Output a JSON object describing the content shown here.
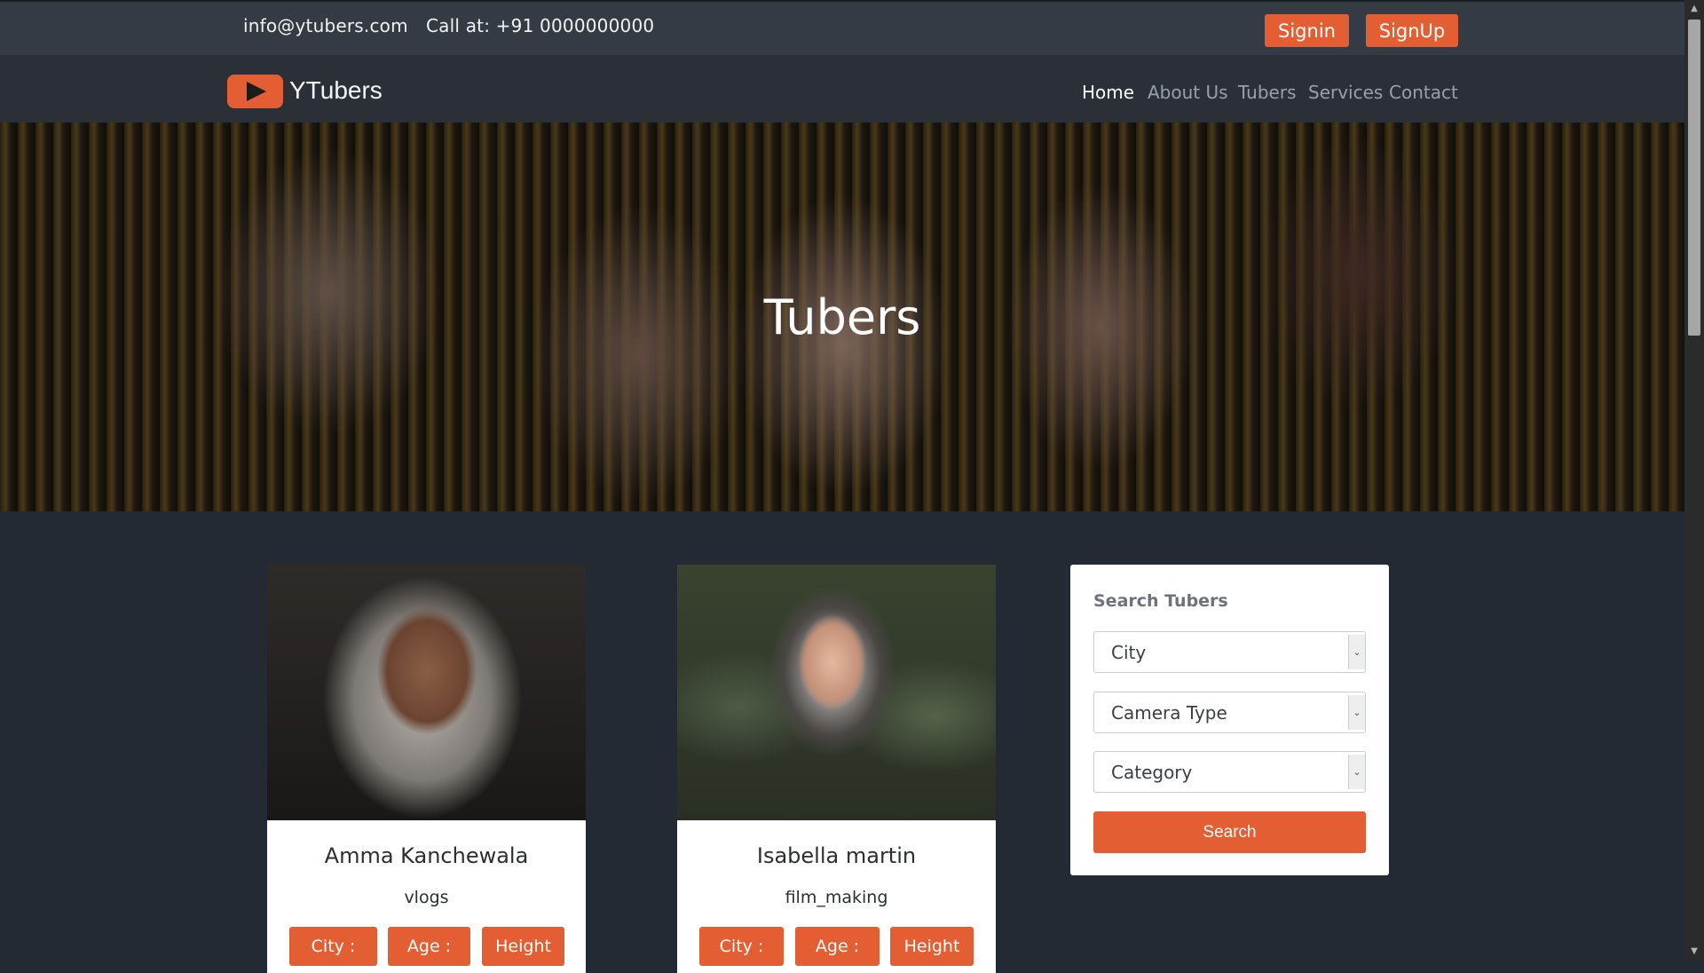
{
  "topbar": {
    "email": "info@ytubers.com",
    "phone": "Call at: +91 0000000000",
    "signin_label": "Signin",
    "signup_label": "SignUp"
  },
  "navbar": {
    "brand": "YTubers",
    "items": [
      {
        "label": "Home",
        "active": true
      },
      {
        "label": "About Us"
      },
      {
        "label": "Tubers"
      },
      {
        "label": "Services"
      },
      {
        "label": "Contact"
      }
    ]
  },
  "hero": {
    "title": "Tubers"
  },
  "tubers": [
    {
      "name": "Amma Kanchewala",
      "category": "vlogs",
      "city_label": "City :",
      "age_label": "Age :",
      "height_label": "Height"
    },
    {
      "name": "Isabella martin",
      "category": "film_making",
      "city_label": "City :",
      "age_label": "Age :",
      "height_label": "Height"
    }
  ],
  "search": {
    "title": "Search Tubers",
    "city_placeholder": "City",
    "camera_placeholder": "Camera Type",
    "category_placeholder": "Category",
    "button_label": "Search"
  },
  "colors": {
    "accent": "#e35f33",
    "topbar": "#353b44",
    "navbar": "#2b3038",
    "page": "#242a33"
  }
}
